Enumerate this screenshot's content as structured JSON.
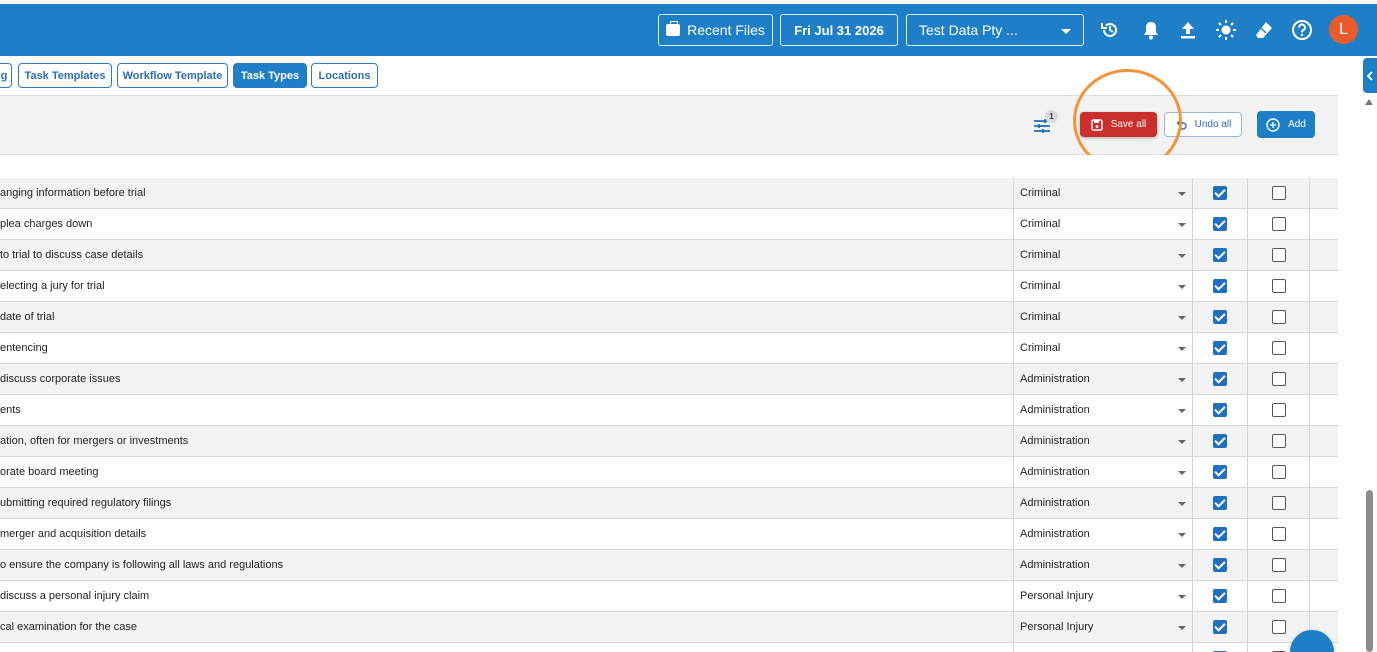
{
  "header": {
    "recent_files": "Recent Files",
    "date": "Fri Jul 31 2026",
    "company": "Test Data Pty ...",
    "avatar_initial": "L",
    "icons": [
      "history-icon",
      "bell-icon",
      "upload-icon",
      "brightness-icon",
      "eraser-icon",
      "help-icon"
    ]
  },
  "tabs": [
    {
      "label": "g",
      "active": false
    },
    {
      "label": "Task Templates",
      "active": false
    },
    {
      "label": "Workflow Template",
      "active": false
    },
    {
      "label": "Task Types",
      "active": true
    },
    {
      "label": "Locations",
      "active": false
    }
  ],
  "toolbar": {
    "filter_badge": "1",
    "save_all": "Save all",
    "undo_all": "Undo all",
    "add": "Add"
  },
  "colors": {
    "primary": "#1f7fc6",
    "save": "#c9302c",
    "highlight": "#f0943a",
    "avatar": "#ea5b2b"
  },
  "rows": [
    {
      "description": "anging information before trial",
      "category": "Criminal",
      "checked_1": true,
      "checked_2": false
    },
    {
      "description": "plea charges down",
      "category": "Criminal",
      "checked_1": true,
      "checked_2": false
    },
    {
      "description": "to trial to discuss case details",
      "category": "Criminal",
      "checked_1": true,
      "checked_2": false
    },
    {
      "description": "electing a jury for trial",
      "category": "Criminal",
      "checked_1": true,
      "checked_2": false
    },
    {
      "description": "date of trial",
      "category": "Criminal",
      "checked_1": true,
      "checked_2": false
    },
    {
      "description": "entencing",
      "category": "Criminal",
      "checked_1": true,
      "checked_2": false
    },
    {
      "description": "discuss corporate issues",
      "category": "Administration",
      "checked_1": true,
      "checked_2": false
    },
    {
      "description": "ents",
      "category": "Administration",
      "checked_1": true,
      "checked_2": false
    },
    {
      "description": "ation, often for mergers or investments",
      "category": "Administration",
      "checked_1": true,
      "checked_2": false
    },
    {
      "description": "orate board meeting",
      "category": "Administration",
      "checked_1": true,
      "checked_2": false
    },
    {
      "description": "ubmitting required regulatory filings",
      "category": "Administration",
      "checked_1": true,
      "checked_2": false
    },
    {
      "description": "merger and acquisition details",
      "category": "Administration",
      "checked_1": true,
      "checked_2": false
    },
    {
      "description": "o ensure the company is following all laws and regulations",
      "category": "Administration",
      "checked_1": true,
      "checked_2": false
    },
    {
      "description": "discuss a personal injury claim",
      "category": "Personal Injury",
      "checked_1": true,
      "checked_2": false
    },
    {
      "description": "cal examination for the case",
      "category": "Personal Injury",
      "checked_1": true,
      "checked_2": false
    },
    {
      "description": "",
      "category": "",
      "checked_1": true,
      "checked_2": false
    }
  ]
}
